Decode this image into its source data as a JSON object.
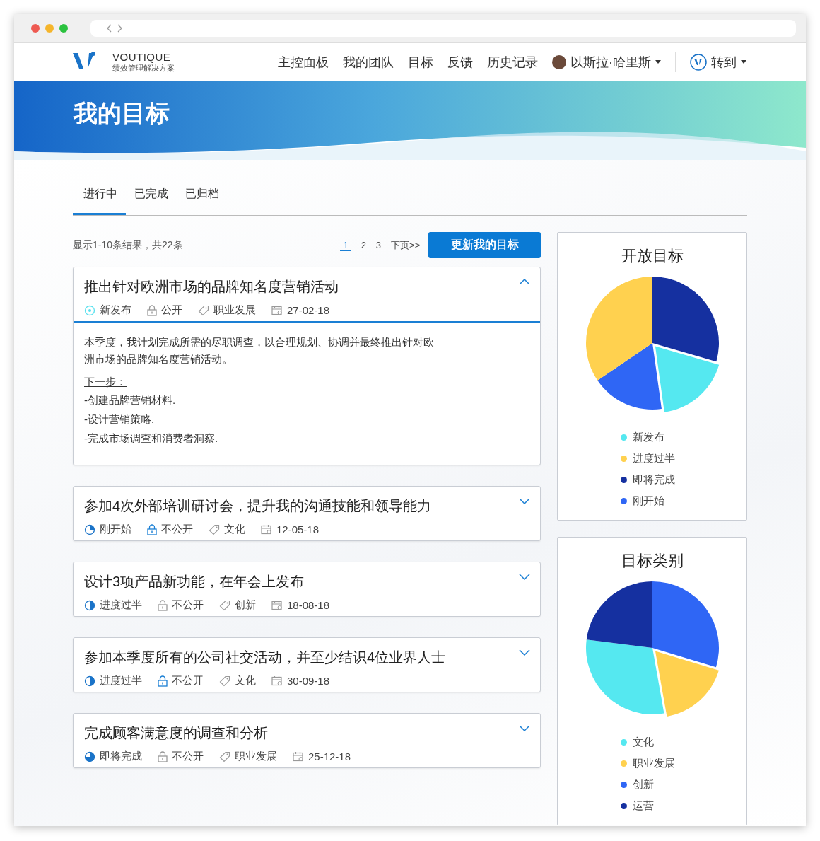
{
  "nav": {
    "brand": "VOUTIQUE",
    "tagline": "绩效管理解决方案",
    "menu": [
      "主控面板",
      "我的团队",
      "目标",
      "反馈",
      "历史记录"
    ],
    "user": "以斯拉·哈里斯",
    "goto": "转到"
  },
  "banner": {
    "title": "我的目标"
  },
  "tabs": [
    {
      "label": "进行中",
      "selected": true
    },
    {
      "label": "已完成",
      "selected": false
    },
    {
      "label": "已归档",
      "selected": false
    }
  ],
  "summary": "显示1-10条结果，共22条",
  "pagination": {
    "pages": [
      {
        "label": "1",
        "selected": true
      },
      {
        "label": "2",
        "selected": false
      },
      {
        "label": "3",
        "selected": false
      }
    ],
    "next": "下页>>"
  },
  "update_button": "更新我的目标",
  "goals": [
    {
      "title": "推出针对欧洲市场的品牌知名度营销活动",
      "expanded": true,
      "status": {
        "label": "新发布",
        "kind": "new"
      },
      "visibility": {
        "label": "公开",
        "highlighted": false
      },
      "category": "职业发展",
      "date": "27-02-18",
      "description": "本季度，我计划完成所需的尽职调查，以合理规划、协调并最终推出针对欧洲市场的品牌知名度营销活动。",
      "next_heading": "下一步：",
      "next_steps": [
        "-创建品牌营销材料.",
        "-设计营销策略.",
        "-完成市场调查和消费者洞察."
      ]
    },
    {
      "title": "参加4次外部培训研讨会，提升我的沟通技能和领导能力",
      "expanded": false,
      "status": {
        "label": "刚开始",
        "kind": "started"
      },
      "visibility": {
        "label": "不公开",
        "highlighted": true
      },
      "category": "文化",
      "date": "12-05-18"
    },
    {
      "title": "设计3项产品新功能，在年会上发布",
      "expanded": false,
      "status": {
        "label": "进度过半",
        "kind": "half"
      },
      "visibility": {
        "label": "不公开",
        "highlighted": false
      },
      "category": "创新",
      "date": "18-08-18"
    },
    {
      "title": "参加本季度所有的公司社交活动，并至少结识4位业界人士",
      "expanded": false,
      "status": {
        "label": "进度过半",
        "kind": "half"
      },
      "visibility": {
        "label": "不公开",
        "highlighted": true
      },
      "category": "文化",
      "date": "30-09-18"
    },
    {
      "title": "完成顾客满意度的调查和分析",
      "expanded": false,
      "status": {
        "label": "即将完成",
        "kind": "nearly"
      },
      "visibility": {
        "label": "不公开",
        "highlighted": false
      },
      "category": "职业发展",
      "date": "25-12-18"
    }
  ],
  "charts": [
    {
      "title": "开放目标",
      "legend": [
        {
          "label": "新发布",
          "color": "#55e8f0"
        },
        {
          "label": "进度过半",
          "color": "#ffd14f"
        },
        {
          "label": "即将完成",
          "color": "#1530a0"
        },
        {
          "label": "刚开始",
          "color": "#2f66f5"
        }
      ]
    },
    {
      "title": "目标类别",
      "legend": [
        {
          "label": "文化",
          "color": "#55e8f0"
        },
        {
          "label": "职业发展",
          "color": "#ffd14f"
        },
        {
          "label": "创新",
          "color": "#2f66f5"
        },
        {
          "label": "运营",
          "color": "#1530a0"
        }
      ]
    }
  ]
}
